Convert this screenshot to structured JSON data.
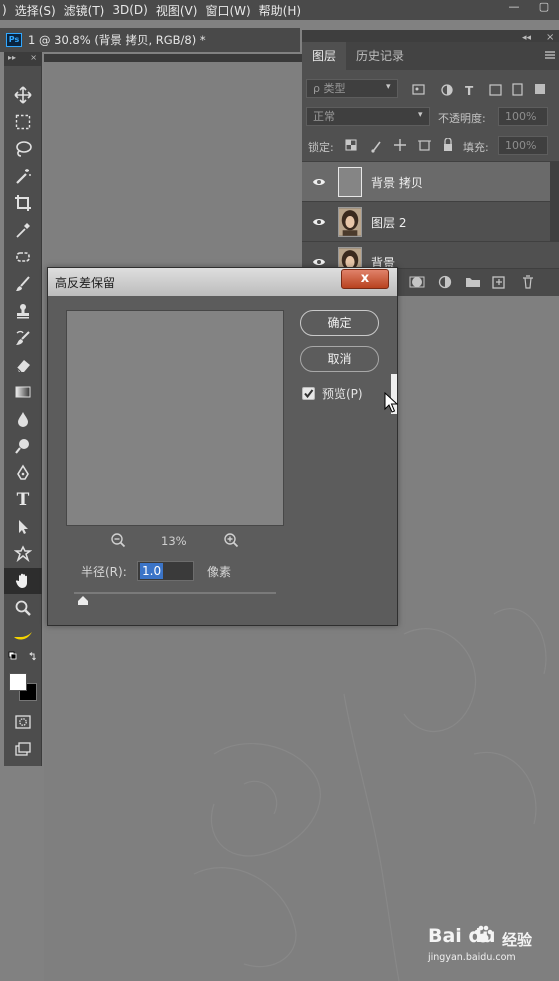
{
  "menubar": {
    "items": [
      ")",
      "选择(S)",
      "滤镜(T)",
      "3D(D)",
      "视图(V)",
      "窗口(W)",
      "帮助(H)"
    ],
    "window_controls": [
      "—",
      "▢"
    ]
  },
  "document": {
    "app_badge": "Ps",
    "tab_title": "1 @ 30.8% (背景 拷贝, RGB/8) *"
  },
  "toolbar": {
    "head": [
      "▸▸",
      "×"
    ],
    "tools": [
      "move-tool",
      "marquee-tool",
      "lasso-tool",
      "magic-wand-tool",
      "crop-tool",
      "eyedropper-tool",
      "healing-brush-tool",
      "brush-tool",
      "clone-stamp-tool",
      "history-brush-tool",
      "eraser-tool",
      "gradient-tool",
      "blur-tool",
      "dodge-tool",
      "pen-tool",
      "type-tool",
      "path-selection-tool",
      "custom-shape-tool",
      "hand-tool",
      "zoom-tool",
      "banana-tool",
      "swap-colors-tool",
      "color-swatches",
      "quick-mask",
      "screen-mode"
    ],
    "active_tool": "hand-tool",
    "type_glyph": "T"
  },
  "layers_panel": {
    "tabs": [
      "图层",
      "历史记录"
    ],
    "active_tab": "图层",
    "filter_placeholder": "ρ 类型",
    "blend_mode": "正常",
    "opacity_label": "不透明度:",
    "opacity_value": "100%",
    "lock_label": "锁定:",
    "fill_label": "填充:",
    "fill_value": "100%",
    "layers": [
      {
        "name": "背景 拷贝",
        "selected": true,
        "thumb": "gray"
      },
      {
        "name": "图层 2",
        "selected": false,
        "thumb": "portrait"
      },
      {
        "name": "背景",
        "selected": false,
        "thumb": "portrait"
      }
    ]
  },
  "dialog": {
    "title": "高反差保留",
    "close_label": "x",
    "ok_label": "确定",
    "cancel_label": "取消",
    "preview_label": "预览(P)",
    "preview_checked": true,
    "zoom_percent": "13%",
    "radius_label": "半径(R):",
    "radius_value": "1.0",
    "unit_label": "像素",
    "slider_position": 0.01
  },
  "watermark": {
    "logo": "Bai du",
    "product": "经验",
    "url": "jingyan.baidu.com"
  },
  "colors": {
    "canvas": "#818181",
    "selection": "#3b74c7",
    "close_button": "#c85a3a"
  }
}
